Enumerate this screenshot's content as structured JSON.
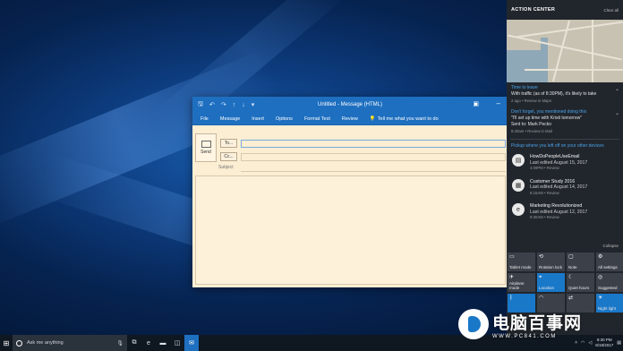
{
  "window": {
    "title": "Untitled - Message (HTML)",
    "quick_access": [
      "save-icon",
      "undo-icon",
      "redo-icon",
      "up-icon",
      "down-icon",
      "customize-icon"
    ],
    "ribbon_tabs": [
      "File",
      "Message",
      "Insert",
      "Options",
      "Format Text",
      "Review"
    ],
    "tell_me": "Tell me what you want to do",
    "send_label": "Send",
    "to_label": "To...",
    "cc_label": "Cc...",
    "subject_label": "Subject"
  },
  "action_center": {
    "title": "ACTION CENTER",
    "clear_all": "Clear all",
    "notifications": [
      {
        "header": "Time to leave",
        "text": "With traffic (as of 8:30PM), it's likely to take",
        "meta": "2 ago  •  Review in Maps"
      },
      {
        "header": "Don't forget, you mentioned doing this",
        "text": "\"I'll set up time with Kristi tomorrow\"",
        "sub": "Sent to: Mark Pecko",
        "meta": "8:40am  •  Review in Mail"
      }
    ],
    "pickup_text": "Pickup where you left off on your other devices",
    "documents": [
      {
        "icon": "document-icon",
        "title": "HowDoPeopleUseEmail",
        "edited": "Last edited August 15, 2017",
        "meta": "4:09PM  •  Review"
      },
      {
        "icon": "folder-icon",
        "title": "Customer Study 2016",
        "edited": "Last edited August 14, 2017",
        "meta": "8:15AM  •  Review"
      },
      {
        "icon": "edge-icon",
        "title": "Marketing Revolutionized",
        "edited": "Last edited August 12, 2017",
        "meta": "9:30AM  •  Review"
      }
    ],
    "collapse": "Collapse",
    "tiles": [
      {
        "icon": "tablet-mode-icon",
        "label": "Tablet mode",
        "on": false
      },
      {
        "icon": "rotation-lock-icon",
        "label": "Rotation lock",
        "on": false
      },
      {
        "icon": "note-icon",
        "label": "Note",
        "on": false
      },
      {
        "icon": "settings-icon",
        "label": "All settings",
        "on": false
      },
      {
        "icon": "airplane-icon",
        "label": "Airplane mode",
        "on": false
      },
      {
        "icon": "location-icon",
        "label": "Location",
        "on": true
      },
      {
        "icon": "quiet-hours-icon",
        "label": "Quiet hours",
        "on": false
      },
      {
        "icon": "suggested-icon",
        "label": "Suggested",
        "on": false
      },
      {
        "icon": "bluetooth-icon",
        "label": "",
        "on": true
      },
      {
        "icon": "wifi-icon",
        "label": "",
        "on": false
      },
      {
        "icon": "vpn-icon",
        "label": "",
        "on": false
      },
      {
        "icon": "night-light-icon",
        "label": "Night light",
        "on": true
      }
    ],
    "colors": {
      "accent": "#1a78c8",
      "link": "#4aa3e8"
    }
  },
  "taskbar": {
    "search_placeholder": "Ask me anything",
    "clock_time": "8:30 PM",
    "clock_date": "8/18/2017"
  },
  "watermark": {
    "cn": "电脑百事网",
    "url": "WWW.PC841.COM"
  }
}
